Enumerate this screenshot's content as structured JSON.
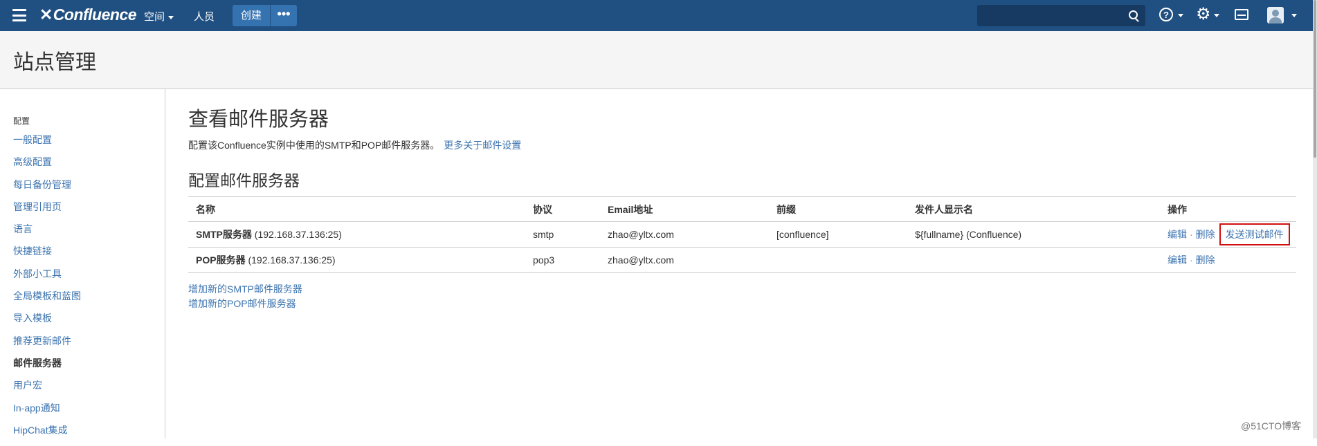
{
  "topnav": {
    "logo": "Confluence",
    "spaces_label": "空间",
    "people_label": "人员",
    "create_label": "创建",
    "more_label": "•••",
    "search_placeholder": ""
  },
  "icons": {
    "menu": "hamburger-menu-icon",
    "logo": "confluence-x-icon",
    "search": "search-icon",
    "help": "help-icon",
    "gear": "gear-icon",
    "notifications": "inbox-icon",
    "avatar": "user-avatar-icon"
  },
  "page": {
    "title": "站点管理"
  },
  "sidebar": {
    "heading": "配置",
    "items": [
      "一般配置",
      "高级配置",
      "每日备份管理",
      "管理引用页",
      "语言",
      "快捷链接",
      "外部小工具",
      "全局模板和蓝图",
      "导入模板",
      "推荐更新邮件",
      "邮件服务器",
      "用户宏",
      "In-app通知",
      "HipChat集成"
    ],
    "active_index": 10
  },
  "main": {
    "title": "查看邮件服务器",
    "description": "配置该Confluence实例中使用的SMTP和POP邮件服务器。",
    "learn_more_link": "更多关于邮件设置",
    "section_title": "配置邮件服务器",
    "table": {
      "headers": [
        "名称",
        "协议",
        "Email地址",
        "前缀",
        "发件人显示名",
        "操作"
      ],
      "rows": [
        {
          "name": "SMTP服务器",
          "host": "(192.168.37.136:25)",
          "protocol": "smtp",
          "email": "zhao@yltx.com",
          "prefix": "[confluence]",
          "from_name": "${fullname} (Confluence)",
          "edit": "编辑",
          "delete": "删除",
          "test": "发送测试邮件"
        },
        {
          "name": "POP服务器",
          "host": "(192.168.37.136:25)",
          "protocol": "pop3",
          "email": "zhao@yltx.com",
          "prefix": "",
          "from_name": "",
          "edit": "编辑",
          "delete": "删除"
        }
      ],
      "separator": "·"
    },
    "add_smtp_link": "增加新的SMTP邮件服务器",
    "add_pop_link": "增加新的POP邮件服务器"
  },
  "colors": {
    "header_bg": "#205081",
    "link": "#3b73af",
    "highlight_border": "#d20f0f"
  },
  "watermark": "@51CTO博客"
}
